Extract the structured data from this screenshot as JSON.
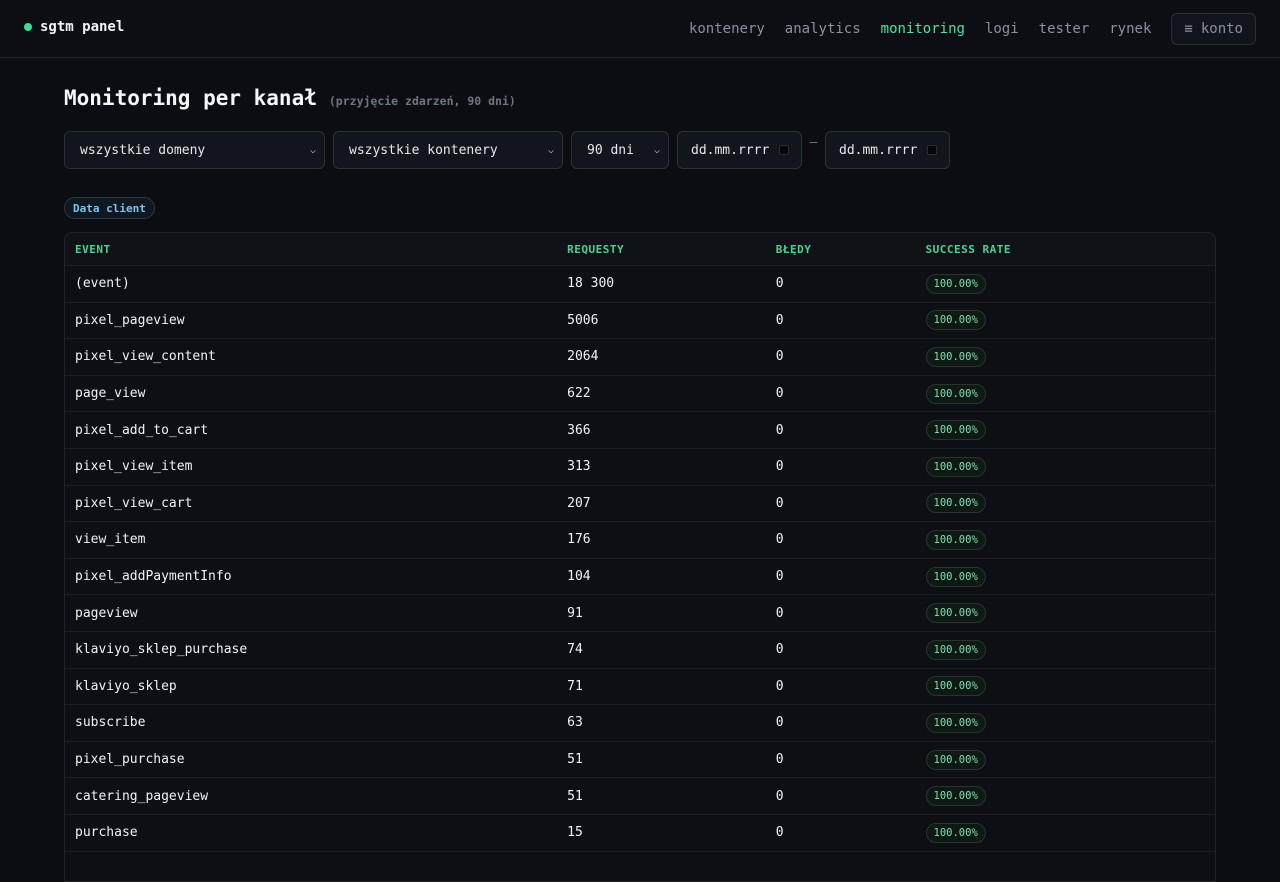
{
  "brand": {
    "name": "sgtm panel"
  },
  "nav": {
    "items": [
      {
        "label": "kontenery"
      },
      {
        "label": "analytics"
      },
      {
        "label": "monitoring"
      },
      {
        "label": "logi"
      },
      {
        "label": "tester"
      },
      {
        "label": "rynek"
      }
    ],
    "account_icon": "≡",
    "account_label": "konto"
  },
  "page": {
    "title": "Monitoring per kanał",
    "subtitle": "(przyjęcie zdarzeń, 90 dni)"
  },
  "filters": {
    "domain": "wszystkie domeny",
    "container": "wszystkie kontenery",
    "range": "90 dni",
    "date_from_placeholder": "dd.mm.rrrr",
    "date_separator": "–",
    "date_to_placeholder": "dd.mm.rrrr"
  },
  "channel": {
    "label": "Data client"
  },
  "table": {
    "headers": [
      "EVENT",
      "REQUESTY",
      "BŁĘDY",
      "SUCCESS RATE"
    ],
    "rows": [
      {
        "event": "(event)",
        "requests": "18 300",
        "errors": "0",
        "rate": "100.00%"
      },
      {
        "event": "pixel_pageview",
        "requests": "5006",
        "errors": "0",
        "rate": "100.00%"
      },
      {
        "event": "pixel_view_content",
        "requests": "2064",
        "errors": "0",
        "rate": "100.00%"
      },
      {
        "event": "page_view",
        "requests": "622",
        "errors": "0",
        "rate": "100.00%"
      },
      {
        "event": "pixel_add_to_cart",
        "requests": "366",
        "errors": "0",
        "rate": "100.00%"
      },
      {
        "event": "pixel_view_item",
        "requests": "313",
        "errors": "0",
        "rate": "100.00%"
      },
      {
        "event": "pixel_view_cart",
        "requests": "207",
        "errors": "0",
        "rate": "100.00%"
      },
      {
        "event": "view_item",
        "requests": "176",
        "errors": "0",
        "rate": "100.00%"
      },
      {
        "event": "pixel_addPaymentInfo",
        "requests": "104",
        "errors": "0",
        "rate": "100.00%"
      },
      {
        "event": "pageview",
        "requests": "91",
        "errors": "0",
        "rate": "100.00%"
      },
      {
        "event": "klaviyo_sklep_purchase",
        "requests": "74",
        "errors": "0",
        "rate": "100.00%"
      },
      {
        "event": "klaviyo_sklep",
        "requests": "71",
        "errors": "0",
        "rate": "100.00%"
      },
      {
        "event": "subscribe",
        "requests": "63",
        "errors": "0",
        "rate": "100.00%"
      },
      {
        "event": "pixel_purchase",
        "requests": "51",
        "errors": "0",
        "rate": "100.00%"
      },
      {
        "event": "catering_pageview",
        "requests": "51",
        "errors": "0",
        "rate": "100.00%"
      },
      {
        "event": "purchase",
        "requests": "15",
        "errors": "0",
        "rate": "100.00%"
      }
    ]
  }
}
